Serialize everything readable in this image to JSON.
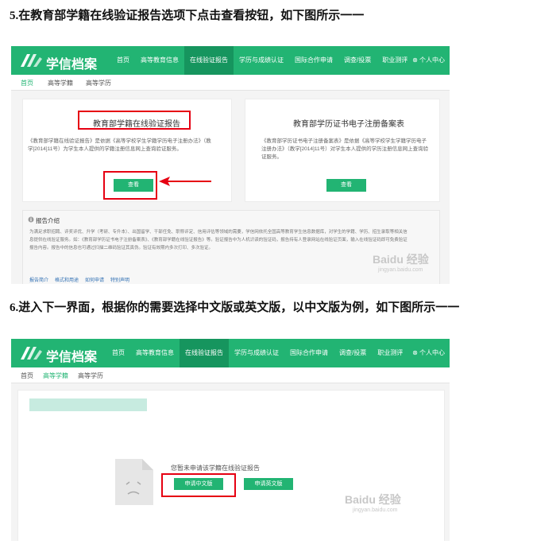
{
  "step5": {
    "text": "5.在教育部学籍在线验证报告选项下点击查看按钮，如下图所示一一"
  },
  "step6": {
    "text": "6.进入下一界面，根据你的需要选择中文版或英文版，以中文版为例，如下图所示一一"
  },
  "screen1": {
    "brand": "学信档案",
    "nav": [
      "首页",
      "高等教育信息",
      "在线验证报告",
      "学历与成绩认证",
      "国际合作申请",
      "调查/投票",
      "职业测评"
    ],
    "nav_active_index": 2,
    "user": "⊗ 个人中心",
    "subtabs": [
      "首页",
      "高等学籍",
      "高等学历"
    ],
    "card_left": {
      "title": "教育部学籍在线验证报告",
      "desc": "《教育部学籍在线验证报告》是依据《高等学校学生学籍学历电子注册办法》（教学[2014]11号）为学生本人提供的学籍注册信息网上查询验证服务。",
      "button": "查看"
    },
    "card_right": {
      "title": "教育部学历证书电子注册备案表",
      "desc": "《教育部学历证书电子注册备案表》是依据《高等学校学生学籍学历电子注册办法》（教学[2014]11号）对学生本人提供的学历注册信息网上查询验证服务。",
      "button": "查看"
    },
    "intro": {
      "title": "报告介绍",
      "text": "为满足求职招聘、评奖评优、升学（考研、专升本）、出国留学、干部任免、职称评定、信用评估等领域的需要，学信网依托全国高等教育学生信息数据库，对学生的学籍、学历、招生录取等相关信息提供在线验证服务。如：《教育部学历证书电子注册备案表》、《教育部学籍在线验证报告》等。验证报告中为人机识读的验证码，报告持有人登录网站在线验证页面，输入在线验证码即可免费验证报告内容。报告中的信息也可通过扫描二维码验证其真伪。验证有效期内多次打印、多次验证。",
      "links": [
        "报告简介",
        "格式和用途",
        "如何申请",
        "特别声明"
      ]
    },
    "watermark": "Baidu 经验",
    "watermark_url": "jingyan.baidu.com"
  },
  "screen2": {
    "brand": "学信档案",
    "nav": [
      "首页",
      "高等教育信息",
      "在线验证报告",
      "学历与成绩认证",
      "国际合作申请",
      "调查/投票",
      "职业测评"
    ],
    "nav_active_index": 2,
    "user": "⊗ 个人中心",
    "subtabs": [
      "首页",
      "高等学籍",
      "高等学历"
    ],
    "empty_msg": "您暂未申请该学籍在线验证报告",
    "btn_cn": "申请中文版",
    "btn_en": "申请英文版",
    "watermark": "Baidu 经验",
    "watermark_url": "jingyan.baidu.com"
  },
  "colors": {
    "brand_green": "#22b473",
    "highlight_red": "#e60012"
  }
}
